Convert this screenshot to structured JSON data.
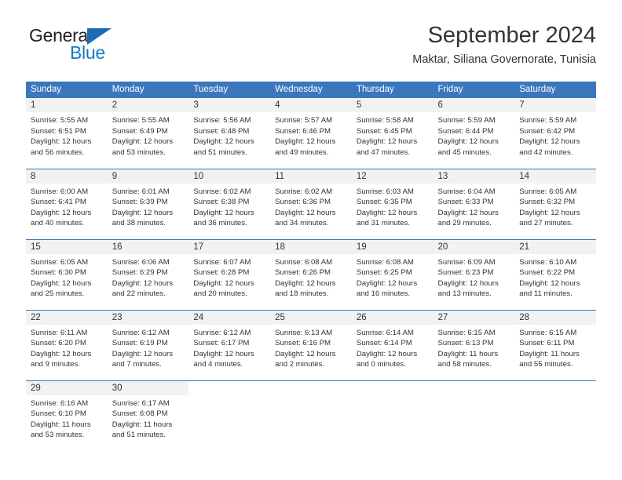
{
  "logo": {
    "text_top": "General",
    "text_bottom": "Blue",
    "triangle_color": "#1c6cb3",
    "blue_color": "#127cc1",
    "dark_color": "#231f20"
  },
  "header": {
    "title": "September 2024",
    "subtitle": "Maktar, Siliana Governorate, Tunisia"
  },
  "theme": {
    "header_row_bg": "#3a77bd",
    "header_row_fg": "#ffffff",
    "daynum_bg": "#f2f2f2",
    "text_color": "#333333",
    "separator_color": "#3a77bd"
  },
  "calendar": {
    "weekday_headers": [
      "Sunday",
      "Monday",
      "Tuesday",
      "Wednesday",
      "Thursday",
      "Friday",
      "Saturday"
    ],
    "weeks": [
      [
        {
          "day": "1",
          "sunrise": "Sunrise: 5:55 AM",
          "sunset": "Sunset: 6:51 PM",
          "daylight_1": "Daylight: 12 hours",
          "daylight_2": "and 56 minutes."
        },
        {
          "day": "2",
          "sunrise": "Sunrise: 5:55 AM",
          "sunset": "Sunset: 6:49 PM",
          "daylight_1": "Daylight: 12 hours",
          "daylight_2": "and 53 minutes."
        },
        {
          "day": "3",
          "sunrise": "Sunrise: 5:56 AM",
          "sunset": "Sunset: 6:48 PM",
          "daylight_1": "Daylight: 12 hours",
          "daylight_2": "and 51 minutes."
        },
        {
          "day": "4",
          "sunrise": "Sunrise: 5:57 AM",
          "sunset": "Sunset: 6:46 PM",
          "daylight_1": "Daylight: 12 hours",
          "daylight_2": "and 49 minutes."
        },
        {
          "day": "5",
          "sunrise": "Sunrise: 5:58 AM",
          "sunset": "Sunset: 6:45 PM",
          "daylight_1": "Daylight: 12 hours",
          "daylight_2": "and 47 minutes."
        },
        {
          "day": "6",
          "sunrise": "Sunrise: 5:59 AM",
          "sunset": "Sunset: 6:44 PM",
          "daylight_1": "Daylight: 12 hours",
          "daylight_2": "and 45 minutes."
        },
        {
          "day": "7",
          "sunrise": "Sunrise: 5:59 AM",
          "sunset": "Sunset: 6:42 PM",
          "daylight_1": "Daylight: 12 hours",
          "daylight_2": "and 42 minutes."
        }
      ],
      [
        {
          "day": "8",
          "sunrise": "Sunrise: 6:00 AM",
          "sunset": "Sunset: 6:41 PM",
          "daylight_1": "Daylight: 12 hours",
          "daylight_2": "and 40 minutes."
        },
        {
          "day": "9",
          "sunrise": "Sunrise: 6:01 AM",
          "sunset": "Sunset: 6:39 PM",
          "daylight_1": "Daylight: 12 hours",
          "daylight_2": "and 38 minutes."
        },
        {
          "day": "10",
          "sunrise": "Sunrise: 6:02 AM",
          "sunset": "Sunset: 6:38 PM",
          "daylight_1": "Daylight: 12 hours",
          "daylight_2": "and 36 minutes."
        },
        {
          "day": "11",
          "sunrise": "Sunrise: 6:02 AM",
          "sunset": "Sunset: 6:36 PM",
          "daylight_1": "Daylight: 12 hours",
          "daylight_2": "and 34 minutes."
        },
        {
          "day": "12",
          "sunrise": "Sunrise: 6:03 AM",
          "sunset": "Sunset: 6:35 PM",
          "daylight_1": "Daylight: 12 hours",
          "daylight_2": "and 31 minutes."
        },
        {
          "day": "13",
          "sunrise": "Sunrise: 6:04 AM",
          "sunset": "Sunset: 6:33 PM",
          "daylight_1": "Daylight: 12 hours",
          "daylight_2": "and 29 minutes."
        },
        {
          "day": "14",
          "sunrise": "Sunrise: 6:05 AM",
          "sunset": "Sunset: 6:32 PM",
          "daylight_1": "Daylight: 12 hours",
          "daylight_2": "and 27 minutes."
        }
      ],
      [
        {
          "day": "15",
          "sunrise": "Sunrise: 6:05 AM",
          "sunset": "Sunset: 6:30 PM",
          "daylight_1": "Daylight: 12 hours",
          "daylight_2": "and 25 minutes."
        },
        {
          "day": "16",
          "sunrise": "Sunrise: 6:06 AM",
          "sunset": "Sunset: 6:29 PM",
          "daylight_1": "Daylight: 12 hours",
          "daylight_2": "and 22 minutes."
        },
        {
          "day": "17",
          "sunrise": "Sunrise: 6:07 AM",
          "sunset": "Sunset: 6:28 PM",
          "daylight_1": "Daylight: 12 hours",
          "daylight_2": "and 20 minutes."
        },
        {
          "day": "18",
          "sunrise": "Sunrise: 6:08 AM",
          "sunset": "Sunset: 6:26 PM",
          "daylight_1": "Daylight: 12 hours",
          "daylight_2": "and 18 minutes."
        },
        {
          "day": "19",
          "sunrise": "Sunrise: 6:08 AM",
          "sunset": "Sunset: 6:25 PM",
          "daylight_1": "Daylight: 12 hours",
          "daylight_2": "and 16 minutes."
        },
        {
          "day": "20",
          "sunrise": "Sunrise: 6:09 AM",
          "sunset": "Sunset: 6:23 PM",
          "daylight_1": "Daylight: 12 hours",
          "daylight_2": "and 13 minutes."
        },
        {
          "day": "21",
          "sunrise": "Sunrise: 6:10 AM",
          "sunset": "Sunset: 6:22 PM",
          "daylight_1": "Daylight: 12 hours",
          "daylight_2": "and 11 minutes."
        }
      ],
      [
        {
          "day": "22",
          "sunrise": "Sunrise: 6:11 AM",
          "sunset": "Sunset: 6:20 PM",
          "daylight_1": "Daylight: 12 hours",
          "daylight_2": "and 9 minutes."
        },
        {
          "day": "23",
          "sunrise": "Sunrise: 6:12 AM",
          "sunset": "Sunset: 6:19 PM",
          "daylight_1": "Daylight: 12 hours",
          "daylight_2": "and 7 minutes."
        },
        {
          "day": "24",
          "sunrise": "Sunrise: 6:12 AM",
          "sunset": "Sunset: 6:17 PM",
          "daylight_1": "Daylight: 12 hours",
          "daylight_2": "and 4 minutes."
        },
        {
          "day": "25",
          "sunrise": "Sunrise: 6:13 AM",
          "sunset": "Sunset: 6:16 PM",
          "daylight_1": "Daylight: 12 hours",
          "daylight_2": "and 2 minutes."
        },
        {
          "day": "26",
          "sunrise": "Sunrise: 6:14 AM",
          "sunset": "Sunset: 6:14 PM",
          "daylight_1": "Daylight: 12 hours",
          "daylight_2": "and 0 minutes."
        },
        {
          "day": "27",
          "sunrise": "Sunrise: 6:15 AM",
          "sunset": "Sunset: 6:13 PM",
          "daylight_1": "Daylight: 11 hours",
          "daylight_2": "and 58 minutes."
        },
        {
          "day": "28",
          "sunrise": "Sunrise: 6:15 AM",
          "sunset": "Sunset: 6:11 PM",
          "daylight_1": "Daylight: 11 hours",
          "daylight_2": "and 55 minutes."
        }
      ],
      [
        {
          "day": "29",
          "sunrise": "Sunrise: 6:16 AM",
          "sunset": "Sunset: 6:10 PM",
          "daylight_1": "Daylight: 11 hours",
          "daylight_2": "and 53 minutes."
        },
        {
          "day": "30",
          "sunrise": "Sunrise: 6:17 AM",
          "sunset": "Sunset: 6:08 PM",
          "daylight_1": "Daylight: 11 hours",
          "daylight_2": "and 51 minutes."
        },
        {
          "day": "",
          "sunrise": "",
          "sunset": "",
          "daylight_1": "",
          "daylight_2": ""
        },
        {
          "day": "",
          "sunrise": "",
          "sunset": "",
          "daylight_1": "",
          "daylight_2": ""
        },
        {
          "day": "",
          "sunrise": "",
          "sunset": "",
          "daylight_1": "",
          "daylight_2": ""
        },
        {
          "day": "",
          "sunrise": "",
          "sunset": "",
          "daylight_1": "",
          "daylight_2": ""
        },
        {
          "day": "",
          "sunrise": "",
          "sunset": "",
          "daylight_1": "",
          "daylight_2": ""
        }
      ]
    ]
  }
}
